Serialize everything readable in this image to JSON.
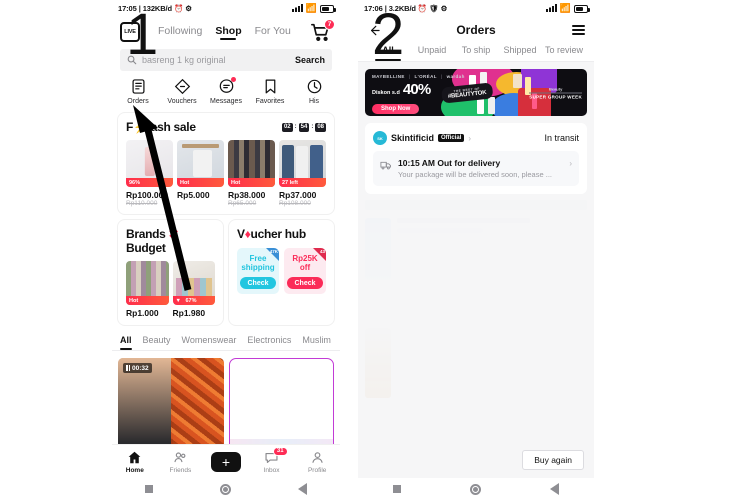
{
  "left_phone": {
    "status_bar": {
      "time": "17:05",
      "data_rate": "132KB/d",
      "icons": [
        "alarm-icon",
        "gear-icon",
        "signal-icon",
        "wifi-icon",
        "battery-icon"
      ]
    },
    "top_nav": {
      "logo_label": "LIVE",
      "tabs": [
        {
          "label": "Following",
          "active": false
        },
        {
          "label": "Shop",
          "active": true
        },
        {
          "label": "For You",
          "active": false
        }
      ],
      "cart_badge": "7"
    },
    "search": {
      "placeholder": "basreng 1 kg original",
      "button_label": "Search"
    },
    "quick_links": [
      {
        "label": "Orders",
        "icon": "orders-icon",
        "badge": false
      },
      {
        "label": "Vouchers",
        "icon": "voucher-icon",
        "badge": false
      },
      {
        "label": "Messages",
        "icon": "message-icon",
        "badge": true
      },
      {
        "label": "Favorites",
        "icon": "bookmark-icon",
        "badge": false
      },
      {
        "label": "His",
        "icon": "history-icon",
        "badge": false
      }
    ],
    "flash_sale": {
      "title": "Flash sale",
      "timer": {
        "hours": "02",
        "minutes": "54",
        "seconds": "08"
      },
      "products": [
        {
          "tag": "96%",
          "price": "Rp100.000",
          "old_price": "Rp110.000"
        },
        {
          "tag": "Hot",
          "price": "Rp5.000",
          "old_price": ""
        },
        {
          "tag": "Hot",
          "price": "Rp38.000",
          "old_price": "Rp65.000"
        },
        {
          "tag": "27 left",
          "price": "Rp37.000",
          "old_price": "Rp108.000"
        }
      ]
    },
    "brands_budget": {
      "title_a": "Brands",
      "title_b": "Budget",
      "products": [
        {
          "tag": "Hot",
          "price": "Rp1.000"
        },
        {
          "tag": "67%",
          "price": "Rp1.980"
        }
      ]
    },
    "voucher_hub": {
      "title": "Voucher hub",
      "coupons": [
        {
          "text": "Free shipping",
          "button": "Check",
          "corner": "47K",
          "theme": "blue"
        },
        {
          "text": "Rp25K off",
          "button": "Check",
          "corner": "43",
          "theme": "pink"
        }
      ]
    },
    "category_tabs": [
      {
        "label": "All",
        "active": true
      },
      {
        "label": "Beauty",
        "active": false
      },
      {
        "label": "Womenswear",
        "active": false
      },
      {
        "label": "Electronics",
        "active": false
      },
      {
        "label": "Muslim",
        "active": false
      }
    ],
    "feed": {
      "video_duration": "00:32"
    },
    "bottom_nav": [
      {
        "label": "Home",
        "icon": "home-icon",
        "active": true,
        "badge": ""
      },
      {
        "label": "Friends",
        "icon": "friends-icon",
        "active": false,
        "badge": ""
      },
      {
        "label": "",
        "icon": "plus-icon",
        "active": false,
        "badge": ""
      },
      {
        "label": "Inbox",
        "icon": "inbox-icon",
        "active": false,
        "badge": "31"
      },
      {
        "label": "Profile",
        "icon": "profile-icon",
        "active": false,
        "badge": ""
      }
    ]
  },
  "right_phone": {
    "status_bar": {
      "time": "17:06",
      "data_rate": "3.2KB/d",
      "icons": [
        "alarm-icon",
        "shield-icon",
        "gear-icon",
        "signal-icon",
        "wifi-icon",
        "battery-icon"
      ]
    },
    "header": {
      "back_icon": "back-arrow-icon",
      "title": "Orders",
      "menu_icon": "hamburger-icon"
    },
    "tabs": [
      {
        "label": "All",
        "active": true
      },
      {
        "label": "Unpaid",
        "active": false
      },
      {
        "label": "To ship",
        "active": false
      },
      {
        "label": "Shipped",
        "active": false
      },
      {
        "label": "To review",
        "active": false
      }
    ],
    "banner": {
      "brands": [
        "MAYBELLINE",
        "L'ORÉAL",
        "wardah"
      ],
      "discount_label": "Diskon s.d",
      "discount_value": "40%",
      "cta": "Shop Now",
      "tag_small": "THE BEST OF",
      "tag_big": "#BEAUTYTOK",
      "right_label_1": "Beauty",
      "right_label_2": "SUPER GROUP WEEK"
    },
    "order_card": {
      "shop_name": "Skintificid",
      "official_badge": "Official",
      "status": "In transit",
      "logistics_title": "10:15 AM Out for delivery",
      "logistics_sub": "Your package will be delivered soon, please ...",
      "truck_icon": "truck-icon"
    },
    "buy_again_label": "Buy again"
  },
  "annotations": {
    "marker_1": "1",
    "marker_2": "2",
    "arrow_color": "#000000"
  }
}
